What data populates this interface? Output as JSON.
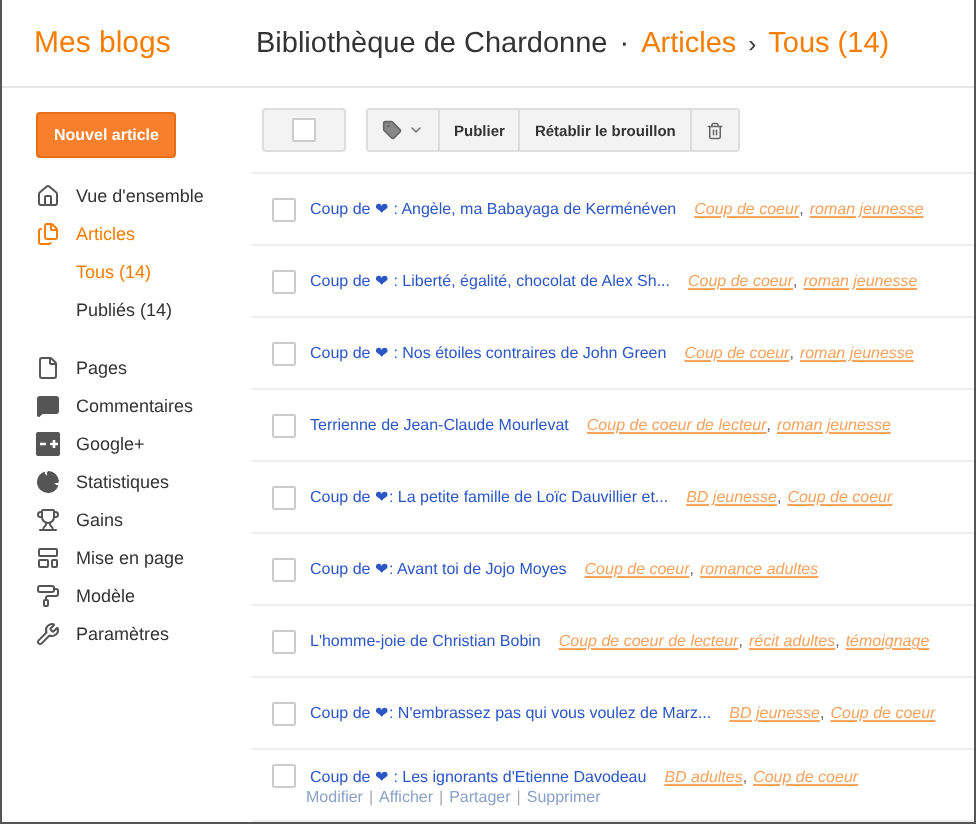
{
  "header": {
    "brand": "Mes blogs",
    "blog_title": "Bibliothèque de Chardonne",
    "separator": "·",
    "section": "Articles",
    "crumb_sep": "›",
    "view": "Tous (14)"
  },
  "sidebar": {
    "new_button": "Nouvel article",
    "groups": [
      {
        "items": [
          {
            "kind": "home",
            "label": "Vue d'ensemble",
            "selected": false
          },
          {
            "kind": "posts",
            "label": "Articles",
            "selected": true,
            "children": [
              {
                "label": "Tous (14)",
                "selected": true
              },
              {
                "label": "Publiés (14)",
                "selected": false
              }
            ]
          }
        ]
      },
      {
        "items": [
          {
            "kind": "pages",
            "label": "Pages",
            "selected": false
          },
          {
            "kind": "comments",
            "label": "Commentaires",
            "selected": false
          },
          {
            "kind": "gplus",
            "label": "Google+",
            "selected": false
          },
          {
            "kind": "stats",
            "label": "Statistiques",
            "selected": false
          },
          {
            "kind": "earnings",
            "label": "Gains",
            "selected": false
          },
          {
            "kind": "layout",
            "label": "Mise en page",
            "selected": false
          },
          {
            "kind": "template",
            "label": "Modèle",
            "selected": false
          },
          {
            "kind": "settings",
            "label": "Paramètres",
            "selected": false
          }
        ]
      }
    ]
  },
  "toolbar": {
    "select_all_checked": false,
    "buttons": [
      "Publier",
      "Rétablir le brouillon"
    ]
  },
  "posts": {
    "label_separator": ",",
    "rows": [
      {
        "title": "Coup de ❤ : Angèle, ma Babayaga de Kerménéven",
        "checked": false,
        "labels": [
          "Coup de coeur",
          "roman jeunesse"
        ]
      },
      {
        "title": "Coup de ❤ : Liberté, égalité, chocolat de Alex Sh...",
        "checked": false,
        "labels": [
          "Coup de coeur",
          "roman jeunesse"
        ]
      },
      {
        "title": "Coup de ❤ : Nos étoiles contraires de John Green",
        "checked": false,
        "labels": [
          "Coup de coeur",
          "roman jeunesse"
        ]
      },
      {
        "title": "Terrienne de Jean-Claude Mourlevat",
        "checked": false,
        "labels": [
          "Coup de coeur de lecteur",
          "roman jeunesse"
        ]
      },
      {
        "title": "Coup de ❤: La petite famille de Loïc Dauvillier et...",
        "checked": false,
        "labels": [
          "BD jeunesse",
          "Coup de coeur"
        ]
      },
      {
        "title": "Coup de ❤: Avant toi de Jojo Moyes",
        "checked": false,
        "labels": [
          "Coup de coeur",
          "romance adultes"
        ]
      },
      {
        "title": "L'homme-joie de Christian Bobin",
        "checked": false,
        "labels": [
          "Coup de coeur de lecteur",
          "récit adultes",
          "témoignage"
        ]
      },
      {
        "title": "Coup de ❤: N'embrassez pas qui vous voulez de Marz...",
        "checked": false,
        "labels": [
          "BD jeunesse",
          "Coup de coeur"
        ]
      },
      {
        "title": "Coup de ❤ : Les ignorants d'Etienne Davodeau",
        "checked": false,
        "labels": [
          "BD adultes",
          "Coup de coeur"
        ],
        "actions": {
          "separator": "|",
          "items": [
            "Modifier",
            "Afficher",
            "Partager",
            "Supprimer"
          ]
        }
      }
    ]
  }
}
